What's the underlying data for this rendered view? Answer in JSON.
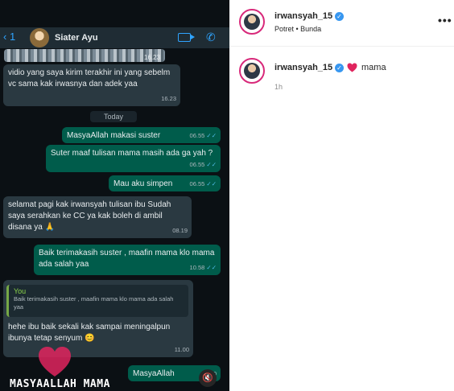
{
  "chat": {
    "back_count": "1",
    "contact_name": "Siater Ayu",
    "image_time": "16.23",
    "date_separator": "Today",
    "messages": [
      {
        "dir": "in",
        "text": "vidio yang saya kirim terakhir ini yang sebelm vc sama kak irwasnya dan adek yaa",
        "time": "16.23"
      },
      {
        "dir": "out",
        "text": "MasyaAllah makasi suster",
        "time": "06.55"
      },
      {
        "dir": "out",
        "text": "Suter maaf tulisan mama masih ada ga yah ?",
        "time": "06.55"
      },
      {
        "dir": "out",
        "text": "Mau aku simpen",
        "time": "06.55"
      },
      {
        "dir": "in",
        "text": "selamat pagi kak irwansyah tulisan ibu Sudah saya serahkan ke CC ya kak boleh di ambil disana ya 🙏",
        "time": "08.19"
      },
      {
        "dir": "out",
        "text": "Baik terimakasih suster , maafin mama klo mama ada salah yaa",
        "time": "10.58"
      },
      {
        "dir": "in",
        "text": "hehe ibu baik sekali kak sampai meningalpun ibunya tetap senyum 😊",
        "time": "11.00"
      },
      {
        "dir": "out",
        "text": "MasyaAllah",
        "time": "11.0"
      }
    ],
    "reply_quote": {
      "author": "You",
      "text": "Baik terimakasih suster , maafin mama klo mama ada salah yaa"
    },
    "overlay_caption": "MASYAALLAH MAMA",
    "check_mark": "✓✓"
  },
  "post": {
    "username": "irwansyah_15",
    "verified_glyph": "✓",
    "subtitle": "Potret • Bunda",
    "more_glyph": "•••",
    "caption_user": "irwansyah_15",
    "caption_text": "mama",
    "time_ago": "1h"
  },
  "icons": {
    "back": "‹",
    "phone": "✆",
    "mute": "🔇"
  },
  "colors": {
    "whatsapp_bg": "#0b1014",
    "incoming_bubble": "#2a3941",
    "outgoing_bubble": "#005c4b",
    "verified_blue": "#3897f0",
    "heart_red": "#e0245e"
  }
}
